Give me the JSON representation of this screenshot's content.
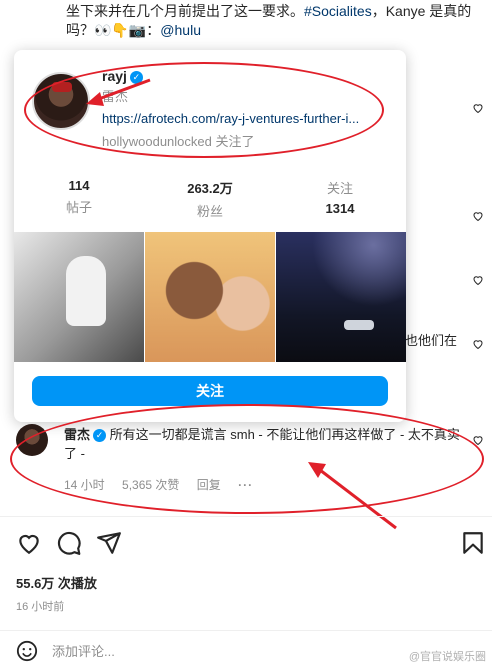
{
  "caption": {
    "line1": "坐下来并在几个月前提出了这一要求。",
    "hashtag": "#Socialites",
    "line1_end": "，Kanye 是真的",
    "line2": "吗？👀👇📷：",
    "mention": "@hulu"
  },
  "background_text": "也他们在",
  "profile_card": {
    "username": "rayj",
    "real_name": "雷杰",
    "link": "https://afrotech.com/ray-j-ventures-further-i...",
    "followed_by": "hollywoodunlocked 关注了",
    "stats": {
      "posts_count": "114",
      "posts_label": "帖子",
      "followers_count": "263.2万",
      "followers_label": "粉丝",
      "following_label": "关注",
      "following_count": "1314"
    },
    "follow_button": "关注"
  },
  "comment": {
    "username": "雷杰",
    "text": "所有这一切都是谎言 smh - 不能让他们再这样做了 - 太不真实了 -",
    "time": "14 小时",
    "likes": "5,365 次赞",
    "reply": "回复",
    "more": "···"
  },
  "post": {
    "plays": "55.6万 次播放",
    "time_ago": "16 小时前",
    "comment_placeholder": "添加评论..."
  },
  "watermark": "@官官说娱乐圈",
  "colors": {
    "accent": "#0095f6",
    "annotation": "#e0202a",
    "link": "#00376b"
  }
}
